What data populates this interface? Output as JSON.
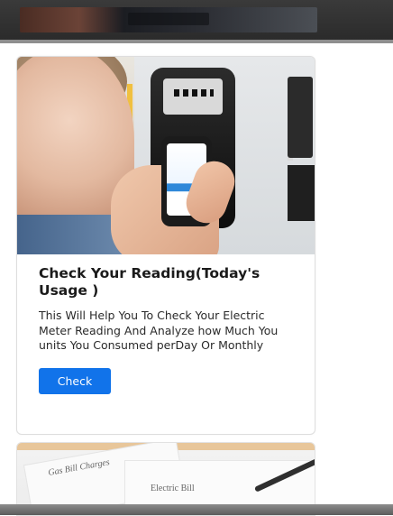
{
  "card": {
    "title": "Check Your Reading(Today's Usage )",
    "description": "This Will Help You To Check Your Electric Meter Reading And Analyze how Much You units You Consumed perDay Or Monthly",
    "button_label": "Check"
  },
  "card2": {
    "paper_label_1": "Gas Bill Charges",
    "paper_label_2": "Electric Bill"
  },
  "colors": {
    "primary_button": "#1173ea"
  }
}
